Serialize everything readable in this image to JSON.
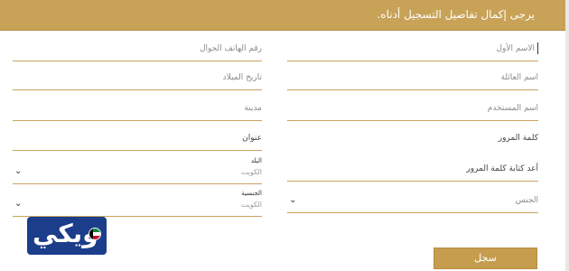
{
  "header": {
    "text": "يرجى إكمال تفاصيل التسجيل أدناه."
  },
  "form": {
    "first_name": "الاسم الأول",
    "phone": "رقم الهاتف الجوال",
    "family_name": "اسم العائلة",
    "birth_date": "تاريخ الميلاد",
    "username": "اسم المستخدم",
    "city": "مدينة",
    "password": "كلمة المرور",
    "address": "عنوان",
    "confirm_password": "أعد كتابة كلمة المرور",
    "country_label": "البلد",
    "country_value": "الكويت",
    "gender": "الجنس",
    "nationality_label": "الجنسية",
    "nationality_value": "الكويت"
  },
  "submit_label": "سجل",
  "logo": {
    "text": "ويكي"
  },
  "colors": {
    "accent": "#c8a257",
    "logo_bg": "#1b3d8a"
  }
}
